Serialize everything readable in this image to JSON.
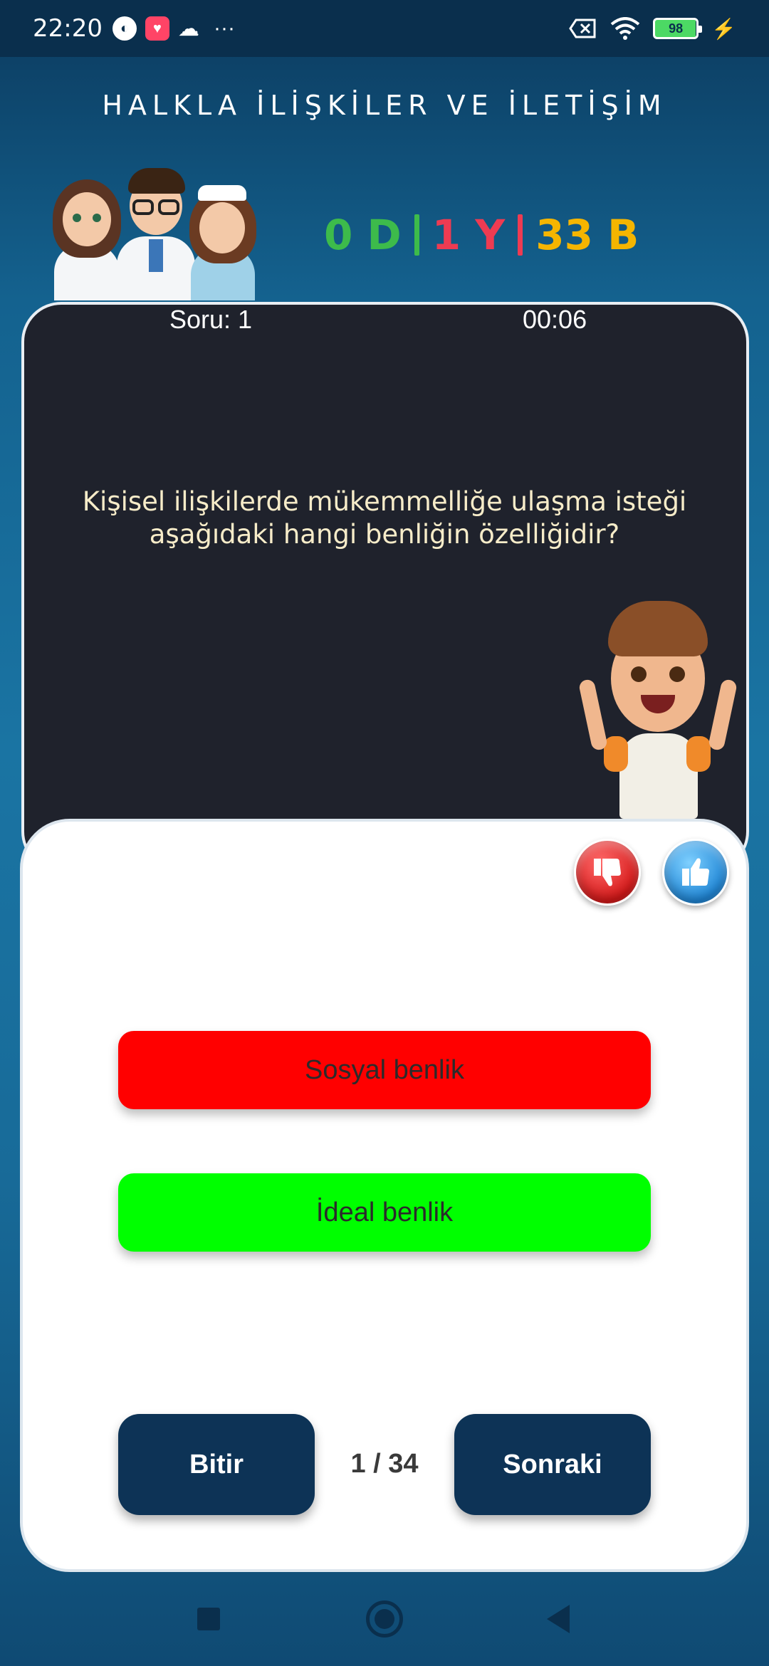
{
  "status_bar": {
    "time": "22:20",
    "more": "···",
    "battery": "98"
  },
  "header": {
    "title": "HALKLA İLİŞKİLER VE İLETİŞİM"
  },
  "score": {
    "correct": "0 D",
    "wrong": "1 Y",
    "blank": "33 B",
    "colors": {
      "correct": "#3dbb4b",
      "wrong": "#ee3b52",
      "blank": "#f5b500"
    }
  },
  "question": {
    "number_label": "Soru: 1",
    "timer": "00:06",
    "text": "Kişisel ilişkilerde mükemmelliğe ulaşma isteği aşağıdaki hangi benliğin özelliğidir?"
  },
  "answers": [
    {
      "label": "Sosyal benlik",
      "state": "wrong",
      "color": "#ff0000"
    },
    {
      "label": "İdeal benlik",
      "state": "correct",
      "color": "#00ff00"
    }
  ],
  "footer": {
    "finish_label": "Bitir",
    "progress": "1 / 34",
    "next_label": "Sonraki"
  }
}
